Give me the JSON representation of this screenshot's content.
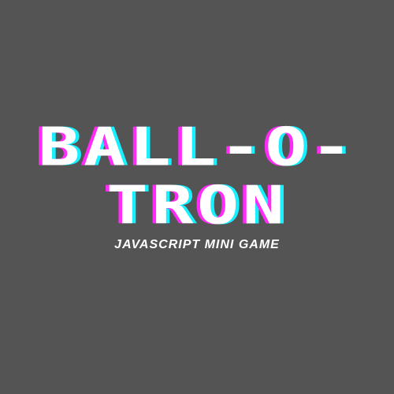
{
  "title": {
    "line1": "BALL-O-",
    "line2": "TRON"
  },
  "subtitle": "JAVASCRIPT MINI GAME",
  "colors": {
    "background": "#545454",
    "text": "#ffffff",
    "accent_magenta": "#ff2cf7",
    "accent_cyan": "#18f0ff"
  }
}
